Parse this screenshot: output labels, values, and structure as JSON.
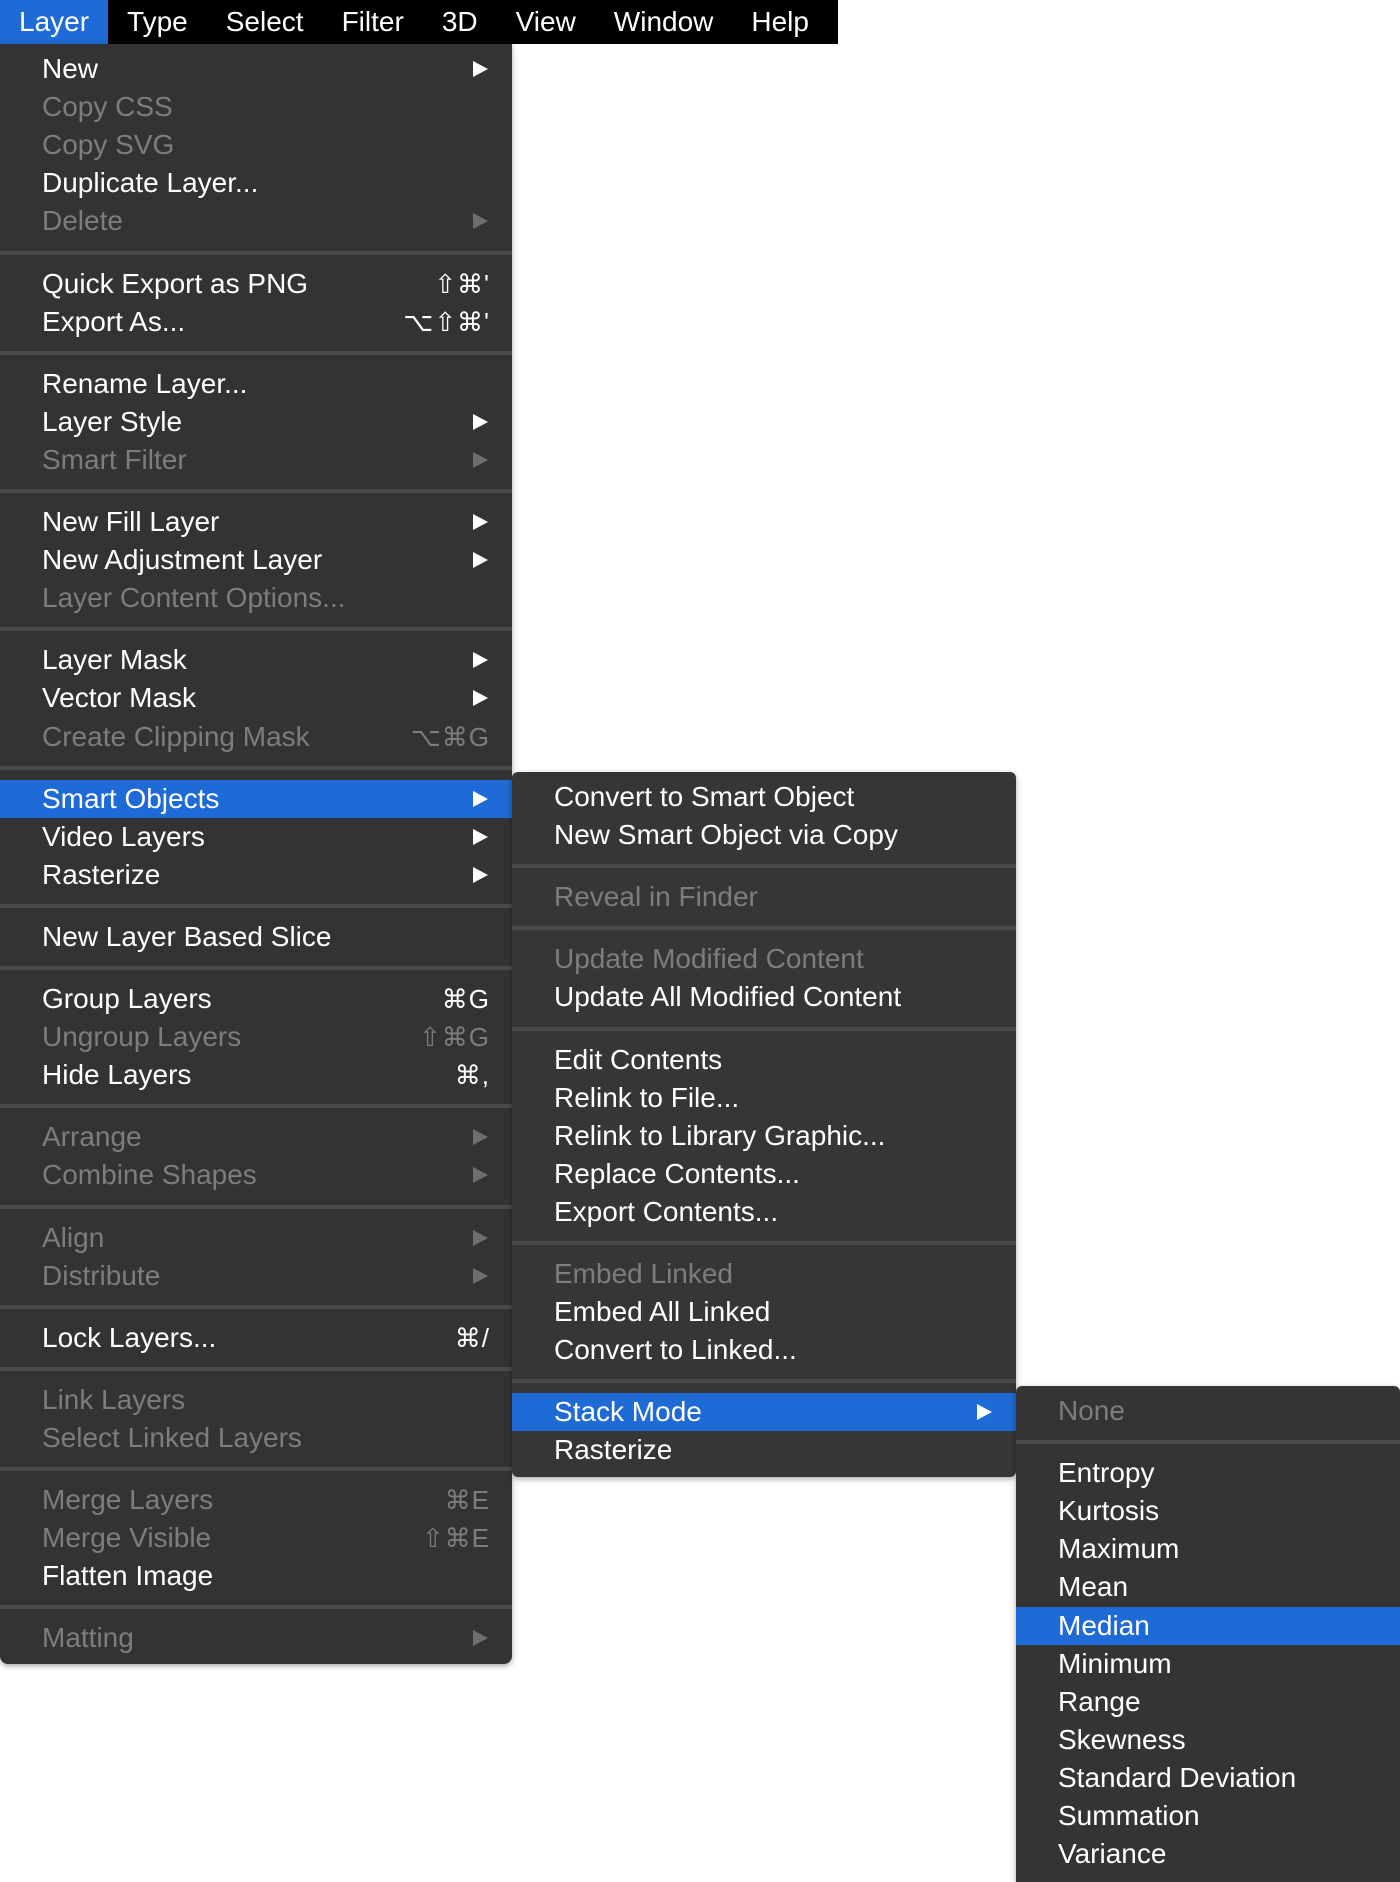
{
  "menubar": [
    "Layer",
    "Type",
    "Select",
    "Filter",
    "3D",
    "View",
    "Window",
    "Help"
  ],
  "layer_menu": [
    {
      "label": "New",
      "disabled": false,
      "arrow": true
    },
    {
      "label": "Copy CSS",
      "disabled": true
    },
    {
      "label": "Copy SVG",
      "disabled": true
    },
    {
      "label": "Duplicate Layer...",
      "disabled": false
    },
    {
      "label": "Delete",
      "disabled": true,
      "arrow": true
    },
    {
      "sep": true
    },
    {
      "label": "Quick Export as PNG",
      "disabled": false,
      "shortcut": "⇧⌘'"
    },
    {
      "label": "Export As...",
      "disabled": false,
      "shortcut": "⌥⇧⌘'"
    },
    {
      "sep": true
    },
    {
      "label": "Rename Layer...",
      "disabled": false
    },
    {
      "label": "Layer Style",
      "disabled": false,
      "arrow": true
    },
    {
      "label": "Smart Filter",
      "disabled": true,
      "arrow": true
    },
    {
      "sep": true
    },
    {
      "label": "New Fill Layer",
      "disabled": false,
      "arrow": true
    },
    {
      "label": "New Adjustment Layer",
      "disabled": false,
      "arrow": true
    },
    {
      "label": "Layer Content Options...",
      "disabled": true
    },
    {
      "sep": true
    },
    {
      "label": "Layer Mask",
      "disabled": false,
      "arrow": true
    },
    {
      "label": "Vector Mask",
      "disabled": false,
      "arrow": true
    },
    {
      "label": "Create Clipping Mask",
      "disabled": true,
      "shortcut": "⌥⌘G"
    },
    {
      "sep": true
    },
    {
      "label": "Smart Objects",
      "disabled": false,
      "arrow": true,
      "highlighted": true
    },
    {
      "label": "Video Layers",
      "disabled": false,
      "arrow": true
    },
    {
      "label": "Rasterize",
      "disabled": false,
      "arrow": true
    },
    {
      "sep": true
    },
    {
      "label": "New Layer Based Slice",
      "disabled": false
    },
    {
      "sep": true
    },
    {
      "label": "Group Layers",
      "disabled": false,
      "shortcut": "⌘G"
    },
    {
      "label": "Ungroup Layers",
      "disabled": true,
      "shortcut": "⇧⌘G"
    },
    {
      "label": "Hide Layers",
      "disabled": false,
      "shortcut": "⌘,"
    },
    {
      "sep": true
    },
    {
      "label": "Arrange",
      "disabled": true,
      "arrow": true
    },
    {
      "label": "Combine Shapes",
      "disabled": true,
      "arrow": true
    },
    {
      "sep": true
    },
    {
      "label": "Align",
      "disabled": true,
      "arrow": true
    },
    {
      "label": "Distribute",
      "disabled": true,
      "arrow": true
    },
    {
      "sep": true
    },
    {
      "label": "Lock Layers...",
      "disabled": false,
      "shortcut": "⌘/"
    },
    {
      "sep": true
    },
    {
      "label": "Link Layers",
      "disabled": true
    },
    {
      "label": "Select Linked Layers",
      "disabled": true
    },
    {
      "sep": true
    },
    {
      "label": "Merge Layers",
      "disabled": true,
      "shortcut": "⌘E"
    },
    {
      "label": "Merge Visible",
      "disabled": true,
      "shortcut": "⇧⌘E"
    },
    {
      "label": "Flatten Image",
      "disabled": false
    },
    {
      "sep": true
    },
    {
      "label": "Matting",
      "disabled": true,
      "arrow": true
    }
  ],
  "smart_objects_menu": [
    {
      "label": "Convert to Smart Object",
      "disabled": false
    },
    {
      "label": "New Smart Object via Copy",
      "disabled": false
    },
    {
      "sep": true
    },
    {
      "label": "Reveal in Finder",
      "disabled": true
    },
    {
      "sep": true
    },
    {
      "label": "Update Modified Content",
      "disabled": true
    },
    {
      "label": "Update All Modified Content",
      "disabled": false
    },
    {
      "sep": true
    },
    {
      "label": "Edit Contents",
      "disabled": false
    },
    {
      "label": "Relink to File...",
      "disabled": false
    },
    {
      "label": "Relink to Library Graphic...",
      "disabled": false
    },
    {
      "label": "Replace Contents...",
      "disabled": false
    },
    {
      "label": "Export Contents...",
      "disabled": false
    },
    {
      "sep": true
    },
    {
      "label": "Embed Linked",
      "disabled": true
    },
    {
      "label": "Embed All Linked",
      "disabled": false
    },
    {
      "label": "Convert to Linked...",
      "disabled": false
    },
    {
      "sep": true
    },
    {
      "label": "Stack Mode",
      "disabled": false,
      "arrow": true,
      "highlighted": true
    },
    {
      "label": "Rasterize",
      "disabled": false
    }
  ],
  "stack_mode_menu": [
    {
      "label": "None",
      "disabled": true
    },
    {
      "sep": true
    },
    {
      "label": "Entropy",
      "disabled": false
    },
    {
      "label": "Kurtosis",
      "disabled": false
    },
    {
      "label": "Maximum",
      "disabled": false
    },
    {
      "label": "Mean",
      "disabled": false
    },
    {
      "label": "Median",
      "disabled": false,
      "highlighted": true
    },
    {
      "label": "Minimum",
      "disabled": false
    },
    {
      "label": "Range",
      "disabled": false
    },
    {
      "label": "Skewness",
      "disabled": false
    },
    {
      "label": "Standard Deviation",
      "disabled": false
    },
    {
      "label": "Summation",
      "disabled": false
    },
    {
      "label": "Variance",
      "disabled": false
    }
  ]
}
